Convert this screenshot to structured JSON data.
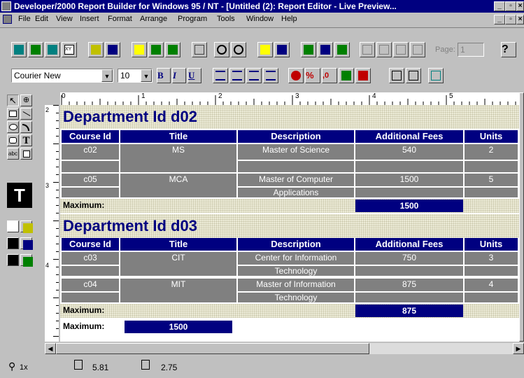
{
  "window": {
    "title": "Developer/2000 Report Builder for Windows 95 / NT - [Untitled (2): Report Editor - Live Preview..."
  },
  "menu": [
    "File",
    "Edit",
    "View",
    "Insert",
    "Format",
    "Arrange",
    "Program",
    "Tools",
    "Window",
    "Help"
  ],
  "toolbar": {
    "page_label": "Page:",
    "page_value": "1",
    "help_label": "?"
  },
  "format_bar": {
    "font": "Courier New",
    "size": "10",
    "bold": "B",
    "italic": "I",
    "underline": "U"
  },
  "report": {
    "columns": [
      "Course Id",
      "Title",
      "Description",
      "Additional Fees",
      "Units"
    ],
    "groups": [
      {
        "title": "Department Id d02",
        "rows": [
          {
            "course_id": "c02",
            "title": "MS",
            "description": "Master of Science",
            "description2": "",
            "fees": "540",
            "units": "2"
          },
          {
            "course_id": "c05",
            "title": "MCA",
            "description": "Master of Computer",
            "description2": "Applications",
            "fees": "1500",
            "units": "5"
          }
        ],
        "max_label": "Maximum:",
        "max_value": "1500"
      },
      {
        "title": "Department Id d03",
        "rows": [
          {
            "course_id": "c03",
            "title": "CIT",
            "description": "Center for Information",
            "description2": "Technology",
            "fees": "750",
            "units": "3"
          },
          {
            "course_id": "c04",
            "title": "MIT",
            "description": "Master of Information",
            "description2": "Technology",
            "fees": "875",
            "units": "4"
          }
        ],
        "max_label": "Maximum:",
        "max_value": "875"
      }
    ],
    "grand_max_label": "Maximum:",
    "grand_max_value": "1500"
  },
  "ruler": {
    "h_marks": [
      "0",
      "1",
      "2",
      "3",
      "4",
      "5"
    ],
    "v_marks": [
      "2",
      "3",
      "4"
    ]
  },
  "status": {
    "zoom": "1x",
    "x": "5.81",
    "y": "2.75"
  },
  "colors": {
    "titlebar": "#000080",
    "header": "#000080",
    "cell": "#808080",
    "band": "#ecebd7"
  }
}
